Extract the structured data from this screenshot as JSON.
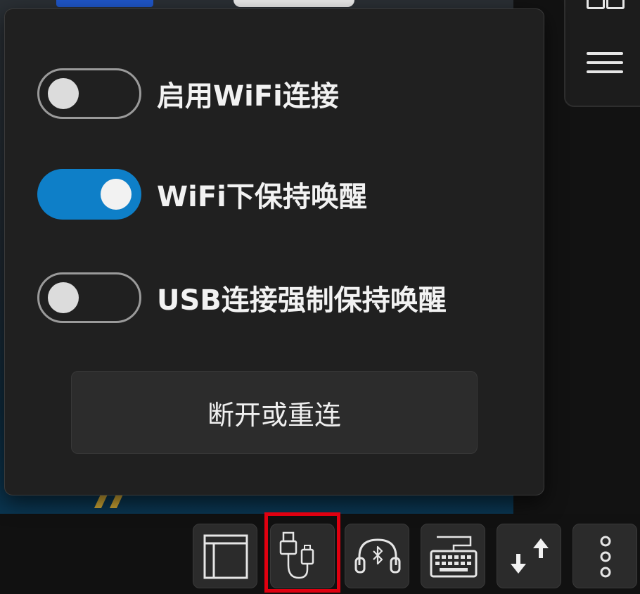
{
  "popup": {
    "toggles": [
      {
        "label": "启用WiFi连接",
        "state": "off"
      },
      {
        "label": "WiFi下保持唤醒",
        "state": "on"
      },
      {
        "label": "USB连接强制保持唤醒",
        "state": "off"
      }
    ],
    "action_button_label": "断开或重连"
  },
  "toolbar": {
    "buttons": [
      {
        "icon": "window-layout-icon"
      },
      {
        "icon": "usb-cable-icon",
        "highlighted": true
      },
      {
        "icon": "bluetooth-headset-icon"
      },
      {
        "icon": "keyboard-icon"
      },
      {
        "icon": "transfer-arrows-icon"
      },
      {
        "icon": "more-vertical-icon"
      }
    ]
  },
  "side_panel": {
    "icons": [
      "grid-icon",
      "menu-icon"
    ]
  },
  "colors": {
    "accent": "#0e7fc8",
    "popup_bg": "#202020",
    "highlight": "#e00010"
  }
}
